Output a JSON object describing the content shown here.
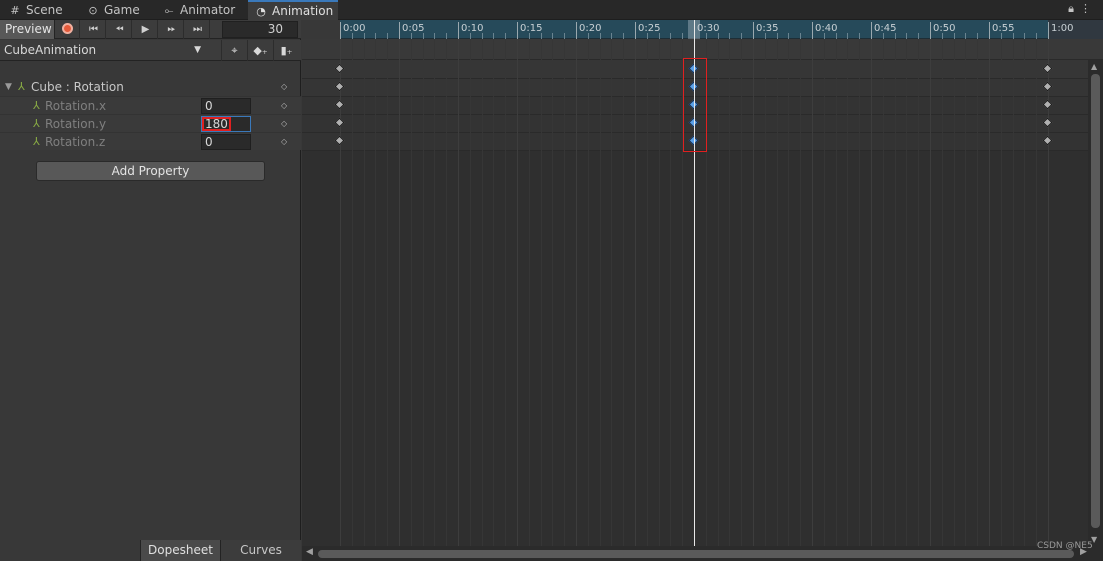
{
  "tabs": [
    {
      "label": "Scene",
      "icon": "#"
    },
    {
      "label": "Game",
      "icon": "⊙"
    },
    {
      "label": "Animator",
      "icon": "⟜"
    },
    {
      "label": "Animation",
      "icon": "◔"
    }
  ],
  "window_icons": [
    "lock-icon",
    "more-icon"
  ],
  "toolbar": {
    "preview_label": "Preview",
    "frame_value": "30",
    "clip_name": "CubeAnimation"
  },
  "properties": {
    "group_label": "Cube : Rotation",
    "items": [
      {
        "label": "Rotation.x",
        "value": "0"
      },
      {
        "label": "Rotation.y",
        "value": "180"
      },
      {
        "label": "Rotation.z",
        "value": "0"
      }
    ]
  },
  "add_property_label": "Add Property",
  "bottom_tabs": {
    "dopesheet": "Dopesheet",
    "curves": "Curves"
  },
  "ruler": {
    "labels": [
      "0:00",
      "0:05",
      "0:10",
      "0:15",
      "0:20",
      "0:25",
      "0:30",
      "0:35",
      "0:40",
      "0:45",
      "0:50",
      "0:55",
      "1:00"
    ]
  },
  "timeline": {
    "keyframe_times": [
      "0:00",
      "0:30",
      "1:00"
    ],
    "current_time": "0:30",
    "selected_keyframe_time": "0:30"
  },
  "watermark": "CSDN @NE5",
  "colors": {
    "accent": "#3a79bb",
    "record": "#e55a3a",
    "highlight_box": "#e02020",
    "selected_key": "#5aa0e8"
  }
}
